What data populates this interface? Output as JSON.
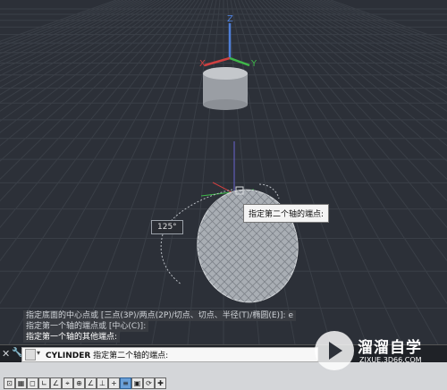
{
  "viewport": {
    "axis_labels": {
      "z": "Z",
      "x": "X",
      "y": "Y"
    },
    "tooltip": "指定第二个轴的端点:",
    "dynamic_input": "125°"
  },
  "history": [
    {
      "text": "指定底面的中心点或 [三点(3P)/两点(2P)/切点、切点、半径(T)/椭圆(E)]: e"
    },
    {
      "text": "指定第一个轴的端点或 [中心(C)]:"
    },
    {
      "text": "指定第一个轴的其他端点:"
    }
  ],
  "command_line": {
    "close_glyph": "✕",
    "wrench_glyph": "🔧",
    "chevron": "▾",
    "command": "CYLINDER",
    "prompt": "指定第二个轴的端点:"
  },
  "watermark": {
    "brand": "溜溜自学",
    "url": "ZIXUE.3D66.COM"
  },
  "status_buttons": [
    {
      "name": "model-space-icon",
      "glyph": "⊡",
      "on": false
    },
    {
      "name": "grid-icon",
      "glyph": "▦",
      "on": false
    },
    {
      "name": "snap-icon",
      "glyph": "◻",
      "on": false
    },
    {
      "name": "ortho-icon",
      "glyph": "∟",
      "on": false
    },
    {
      "name": "polar-icon",
      "glyph": "∠",
      "on": false
    },
    {
      "name": "osnap-icon",
      "glyph": "⌖",
      "on": false
    },
    {
      "name": "3d-osnap-icon",
      "glyph": "⊕",
      "on": false
    },
    {
      "name": "otrack-icon",
      "glyph": "∠",
      "on": false
    },
    {
      "name": "ucs-icon",
      "glyph": "⊥",
      "on": false
    },
    {
      "name": "dyn-icon",
      "glyph": "+",
      "on": false
    },
    {
      "name": "lineweight-icon",
      "glyph": "≡",
      "on": true
    },
    {
      "name": "transparency-icon",
      "glyph": "▣",
      "on": false
    },
    {
      "name": "selection-cycling-icon",
      "glyph": "⟳",
      "on": false
    },
    {
      "name": "annotation-monitor-icon",
      "glyph": "✚",
      "on": false
    }
  ]
}
